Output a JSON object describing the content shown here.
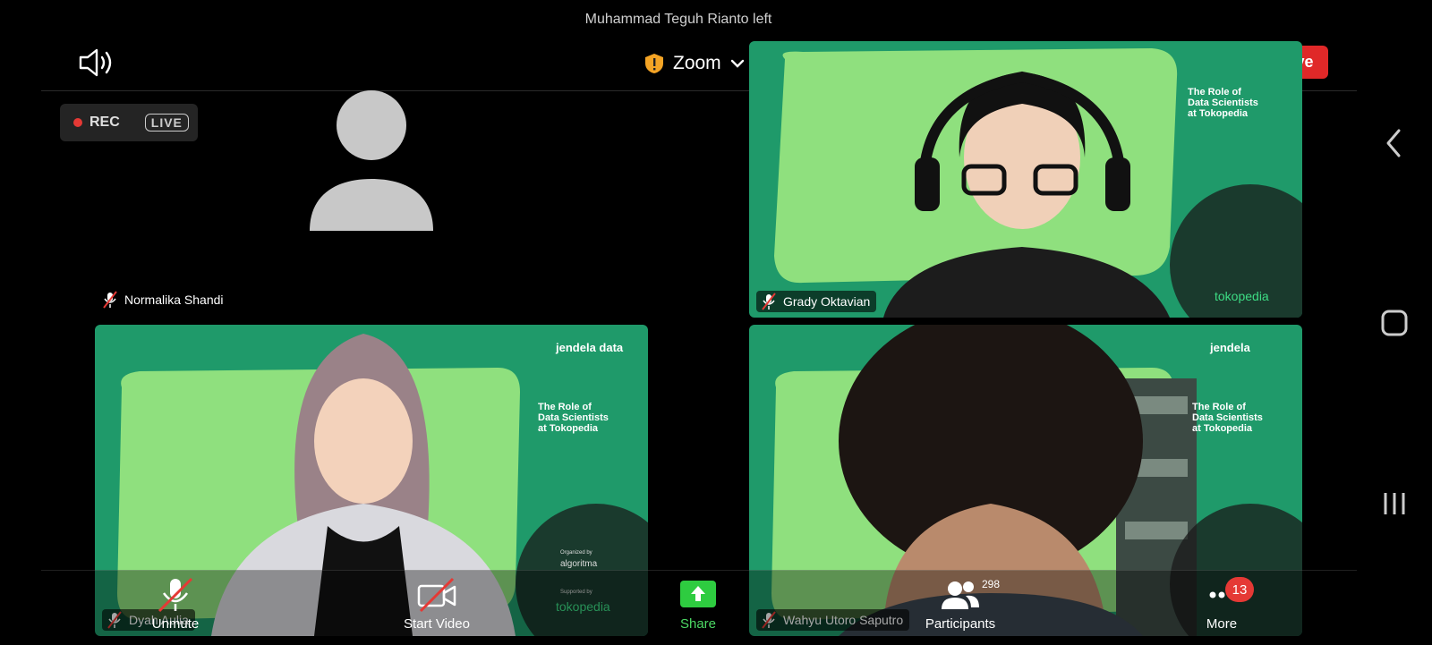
{
  "notification": "Muhammad Teguh Rianto left",
  "header": {
    "title": "Zoom",
    "leave_label": "Leave"
  },
  "recording": {
    "rec_label": "REC",
    "live_label": "LIVE"
  },
  "participants_tiles": [
    {
      "name": "Normalika Shandi",
      "muted": true,
      "video": false
    },
    {
      "name": "Grady Oktavian",
      "muted": true,
      "video": true
    },
    {
      "name": "Dyah Aulia",
      "muted": true,
      "video": true
    },
    {
      "name": "Wahyu Utoro Saputro",
      "muted": true,
      "video": true
    }
  ],
  "slide": {
    "brand": "jendela data",
    "headline_lines": [
      "The Role of",
      "Data Scientists",
      "at Tokopedia"
    ],
    "organized_by": "Organized by",
    "organizer": "algoritma",
    "supported_by": "Supported by",
    "sponsor": "tokopedia"
  },
  "toolbar": {
    "unmute": "Unmute",
    "start_video": "Start Video",
    "share": "Share",
    "participants": "Participants",
    "participants_count": "298",
    "more": "More",
    "more_badge": "13"
  },
  "colors": {
    "leave": "#e02828",
    "share": "#2ecc40",
    "badge": "#e53935",
    "slide_green": "#1f9a6a"
  }
}
